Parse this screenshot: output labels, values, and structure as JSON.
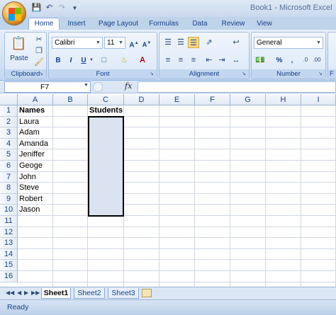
{
  "window": {
    "title": "Book1 - Microsoft Excel"
  },
  "qat": {
    "save_icon": "save-icon",
    "undo_icon": "undo-icon",
    "redo_icon": "redo-icon",
    "customize_icon": "chevron-down-icon"
  },
  "tabs": [
    {
      "label": "Home",
      "active": true
    },
    {
      "label": "Insert"
    },
    {
      "label": "Page Layout"
    },
    {
      "label": "Formulas"
    },
    {
      "label": "Data"
    },
    {
      "label": "Review"
    },
    {
      "label": "View"
    }
  ],
  "ribbon": {
    "clipboard": {
      "label": "Clipboard",
      "paste": "Paste"
    },
    "font": {
      "label": "Font",
      "name": "Calibri",
      "size": "11",
      "bold": "B",
      "italic": "I",
      "underline": "U"
    },
    "alignment": {
      "label": "Alignment"
    },
    "number": {
      "label": "Number",
      "format": "General",
      "percent": "%",
      "comma": ","
    },
    "overflow": {
      "label": "F"
    }
  },
  "formula_bar": {
    "name_box": "F7",
    "fx": "fx",
    "value": ""
  },
  "columns": [
    "A",
    "B",
    "C",
    "D",
    "E",
    "F",
    "G",
    "H",
    "I"
  ],
  "rows": [
    "1",
    "2",
    "3",
    "4",
    "5",
    "6",
    "7",
    "8",
    "9",
    "10",
    "11",
    "12",
    "13",
    "14",
    "15",
    "16"
  ],
  "cells": {
    "A1": "Names",
    "C1": "Students",
    "A2": "Laura",
    "A3": "Adam",
    "A4": "Amanda",
    "A5": "Jeniffer",
    "A6": "Geoge",
    "A7": "John",
    "A8": "Steve",
    "A9": "Robert",
    "A10": "Jason"
  },
  "selection": {
    "range": "C2:C10"
  },
  "sheets": [
    {
      "label": "Sheet1",
      "active": true
    },
    {
      "label": "Sheet2"
    },
    {
      "label": "Sheet3"
    }
  ],
  "status": {
    "text": "Ready"
  },
  "colors": {
    "ribbon_bg": "#d3e2f5",
    "header_text": "#15428b",
    "selection_fill": "#dbe3f1"
  }
}
